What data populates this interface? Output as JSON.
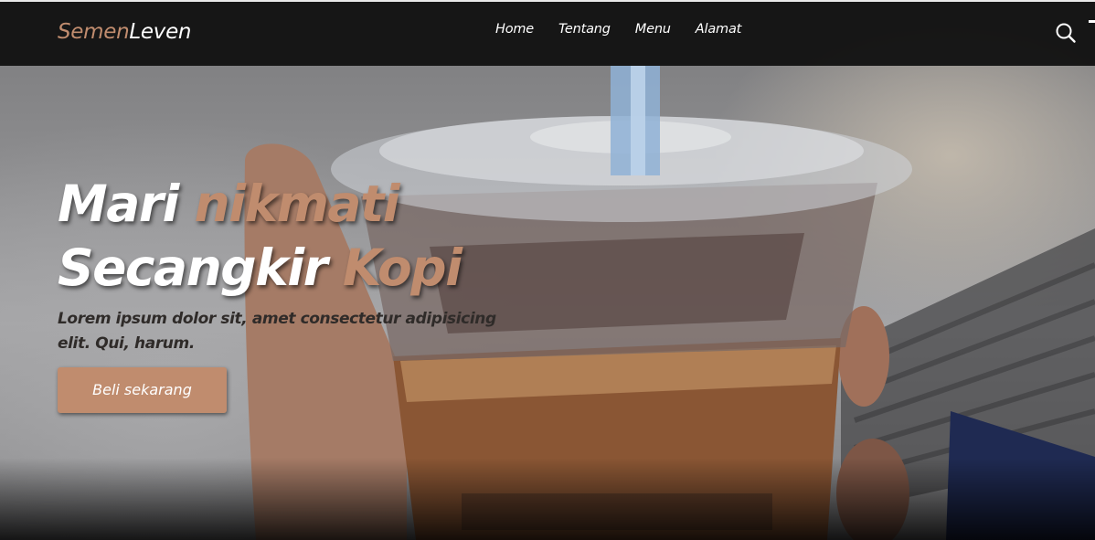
{
  "brand": {
    "part1": "Semen",
    "part2": "Leven"
  },
  "nav": {
    "items": [
      {
        "label": "Home"
      },
      {
        "label": "Tentang"
      },
      {
        "label": "Menu"
      },
      {
        "label": "Alamat"
      }
    ],
    "search_icon": "search-icon"
  },
  "hero": {
    "headline": {
      "line1_white": "Mari",
      "line1_accent": "nikmati",
      "line2_white": "Secangkir",
      "line2_accent": "Kopi"
    },
    "subtext": "Lorem ipsum dolor sit, amet consectetur adipisicing elit. Qui, harum.",
    "cta_label": "Beli sekarang",
    "background": "iced-coffee-cup-photo"
  },
  "colors": {
    "accent": "#c08c6e",
    "navbar": "#121212",
    "text_light": "#ffffff"
  }
}
